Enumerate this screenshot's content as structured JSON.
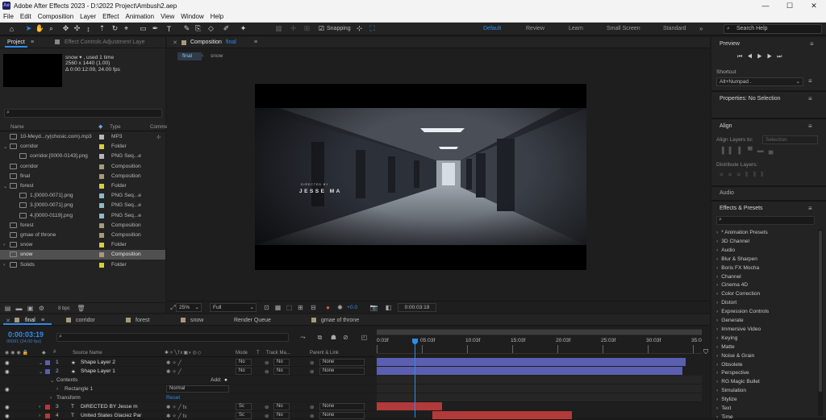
{
  "title_bar": {
    "title": "Adobe After Effects 2023 - D:\\2022 Project\\Ambush2.aep",
    "logo": "Ae",
    "minimize": "—",
    "maximize": "☐",
    "close": "✕"
  },
  "menu": [
    "File",
    "Edit",
    "Composition",
    "Layer",
    "Effect",
    "Animation",
    "View",
    "Window",
    "Help"
  ],
  "toolbar": {
    "snapping_label": "Snapping",
    "workspaces": [
      "Default",
      "Review",
      "Learn",
      "Small Screen",
      "Standard"
    ],
    "search_placeholder": "Search Help"
  },
  "project_panel": {
    "tabs": [
      "Project",
      "Effect Controls Adjustment Laye"
    ],
    "info": {
      "name": "snow ▾ , used 1 time",
      "size": "2560 x 1440 (1.00)",
      "duration": "Δ 0:00:12:09, 24.00 fps"
    },
    "columns": {
      "name": "Name",
      "type": "Type",
      "comment": "Comme"
    },
    "items": [
      {
        "name": "10-Meyd...ry(chosic.com).mp3",
        "type": "MP3",
        "color": "#b5b5b5",
        "indent": 0,
        "arrow": ""
      },
      {
        "name": "corridor",
        "type": "Folder",
        "color": "#d8cf3a",
        "indent": 0,
        "arrow": "⌄"
      },
      {
        "name": "corridor.[0000-0143].png",
        "type": "PNG Seq...e",
        "color": "#b5b5b5",
        "indent": 1,
        "arrow": ""
      },
      {
        "name": "corridor",
        "type": "Composition",
        "color": "#a89a7a",
        "indent": 0,
        "arrow": ""
      },
      {
        "name": "final",
        "type": "Composition",
        "color": "#a89a7a",
        "indent": 0,
        "arrow": ""
      },
      {
        "name": "forest",
        "type": "Folder",
        "color": "#d8cf3a",
        "indent": 0,
        "arrow": "⌄"
      },
      {
        "name": "1.[0000-0071].png",
        "type": "PNG Seq...e",
        "color": "#8fb8c8",
        "indent": 1,
        "arrow": ""
      },
      {
        "name": "3.[0000-0071].png",
        "type": "PNG Seq...e",
        "color": "#8fb8c8",
        "indent": 1,
        "arrow": ""
      },
      {
        "name": "4.[0000-0119].png",
        "type": "PNG Seq...e",
        "color": "#8fb8c8",
        "indent": 1,
        "arrow": ""
      },
      {
        "name": "forest",
        "type": "Composition",
        "color": "#a89a7a",
        "indent": 0,
        "arrow": ""
      },
      {
        "name": "gmae of throne",
        "type": "Composition",
        "color": "#a89a7a",
        "indent": 0,
        "arrow": ""
      },
      {
        "name": "snow",
        "type": "Folder",
        "color": "#d8cf3a",
        "indent": 0,
        "arrow": "›"
      },
      {
        "name": "snow",
        "type": "Composition",
        "color": "#a89a7a",
        "indent": 0,
        "arrow": "",
        "selected": true
      },
      {
        "name": "Solids",
        "type": "Folder",
        "color": "#d8cf3a",
        "indent": 0,
        "arrow": "›"
      }
    ],
    "bpc": "8 bpc"
  },
  "composition_panel": {
    "tab": "Composition",
    "tab_name": "final",
    "breadcrumbs": [
      "final",
      "snow"
    ],
    "overlay_small": "DIRECTED BY",
    "overlay_big": "JESSE MA",
    "zoom": "25%",
    "resolution": "Full",
    "exposure": "+0.0",
    "timecode": "0:00:03:19"
  },
  "right_panel": {
    "preview_title": "Preview",
    "shortcut_label": "Shortcut",
    "shortcut_value": "Alt+Numpad .",
    "properties_title": "Properties: No Selection",
    "align_title": "Align",
    "align_layers_to": "Align Layers to:",
    "align_selection": "Selection",
    "distribute_layers": "Distribute Layers:",
    "audio_title": "Audio",
    "effects_title": "Effects & Presets",
    "effects": [
      "* Animation Presets",
      "3D Channel",
      "Audio",
      "Blur & Sharpen",
      "Boris FX Mocha",
      "Channel",
      "Cinema 4D",
      "Color Correction",
      "Distort",
      "Expression Controls",
      "Generate",
      "Immersive Video",
      "Keying",
      "Matte",
      "Noise & Grain",
      "Obsolete",
      "Perspective",
      "RG Magic Bullet",
      "Simulation",
      "Stylize",
      "Text",
      "Time"
    ]
  },
  "timeline": {
    "tabs": [
      {
        "label": "final",
        "color": "#a89a7a"
      },
      {
        "label": "corridor",
        "color": "#a89a7a"
      },
      {
        "label": "forest",
        "color": "#a89a7a"
      },
      {
        "label": "snow",
        "color": "#a89a7a"
      },
      {
        "label": "Render Queue",
        "color": ""
      },
      {
        "label": "gmae of throne",
        "color": "#a89a7a"
      }
    ],
    "timecode": "0:00:03:19",
    "frame_info": "00091 (24.00 fps)",
    "columns": {
      "source": "Source Name",
      "mode": "Mode",
      "t": "T",
      "trackmatte": "Track Ma...",
      "parent": "Parent & Link"
    },
    "ruler": [
      "0:03f",
      "05:03f",
      "10:03f",
      "15:03f",
      "20:03f",
      "25:03f",
      "30:03f",
      "35:0"
    ],
    "layers": [
      {
        "num": "1",
        "type": "★",
        "name": "Shape Layer 2",
        "mode": "No",
        "tm": "No",
        "parent": "None",
        "color": "#5a5fb0",
        "bar": [
          0,
          0.95
        ]
      },
      {
        "num": "2",
        "type": "★",
        "name": "Shape Layer 1",
        "mode": "No",
        "tm": "No",
        "parent": "None",
        "color": "#5a5fb0",
        "bar": [
          0,
          0.94
        ]
      },
      {
        "num": "3",
        "type": "T",
        "name": "DIRECTED BY Jesse m",
        "mode": "Sc",
        "tm": "No",
        "parent": "None",
        "color": "#b23a3a",
        "bar": [
          0,
          0.2
        ]
      },
      {
        "num": "4",
        "type": "T",
        "name": "United States Glaciez Par",
        "mode": "Sc",
        "tm": "No",
        "parent": "None",
        "color": "#b23a3a",
        "bar": [
          0.17,
          0.6
        ]
      }
    ],
    "sub": {
      "contents": "Contents",
      "add": "Add:",
      "rect": "Rectangle 1",
      "rect_mode": "Normal",
      "transform": "Transform",
      "reset": "Reset"
    }
  }
}
